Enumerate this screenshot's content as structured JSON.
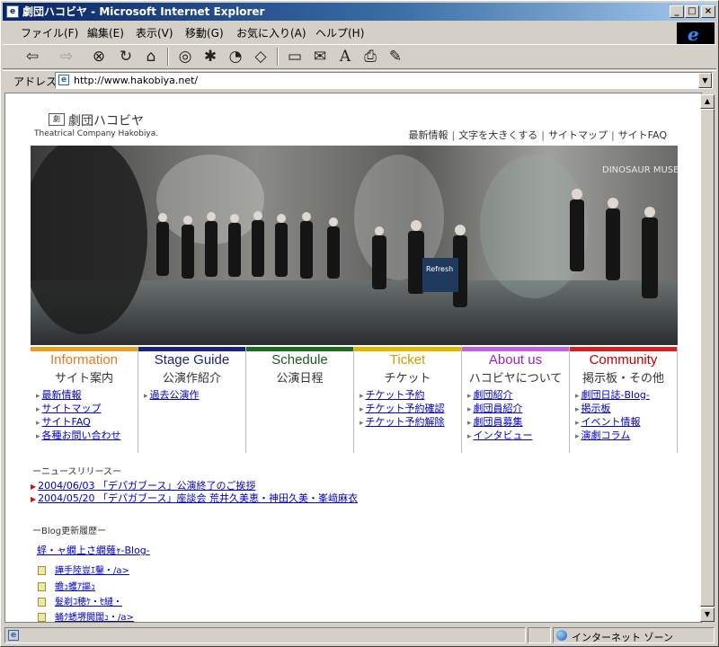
{
  "window": {
    "title": "劇団ハコビヤ - Microsoft Internet Explorer",
    "controls": [
      "_",
      "□",
      "×"
    ]
  },
  "menu": [
    "ファイル(F)",
    "編集(E)",
    "表示(V)",
    "移動(G)",
    "お気に入り(A)",
    "ヘルプ(H)"
  ],
  "toolbar": {
    "back": "⇦",
    "forward": "⇨",
    "stop": "⊗",
    "refresh": "↻",
    "home": "⌂",
    "search": "◎",
    "favorites": "✱",
    "history": "◔",
    "channels": "◇",
    "fullscreen": "▭",
    "mail": "✉",
    "font": "A",
    "print": "⎙",
    "edit": "✎"
  },
  "address": {
    "label": "アドレス",
    "url": "http://www.hakobiya.net/"
  },
  "page": {
    "logo_mark": "劇",
    "logo_jp": "劇団ハコビヤ",
    "logo_en": "Theatrical Company Hakobiya.",
    "topnav": [
      "最新情報",
      "文字を大きくする",
      "サイトマップ",
      "サイトFAQ"
    ],
    "hero_sign": "DINOSAUR MUSEUM",
    "hero_shirt": "Refresh",
    "categories": [
      {
        "en": "Information",
        "jp": "サイト案内",
        "color": "#e87722",
        "bar": "#e8a020",
        "links": [
          "最新情報",
          "サイトマップ",
          "サイトFAQ",
          "各種お問い合わせ"
        ]
      },
      {
        "en": "Stage Guide",
        "jp": "公演作紹介",
        "color": "#1a237e",
        "bar": "#1a237e",
        "links": [
          "過去公演作"
        ]
      },
      {
        "en": "Schedule",
        "jp": "公演日程",
        "color": "#1b5e20",
        "bar": "#1b6e20",
        "links": []
      },
      {
        "en": "Ticket",
        "jp": "チケット",
        "color": "#c9a000",
        "bar": "#e0b800",
        "links": [
          "チケット予約",
          "チケット予約確認",
          "チケット予約解除"
        ]
      },
      {
        "en": "About us",
        "jp": "ハコビヤについて",
        "color": "#a020c0",
        "bar": "#c060e0",
        "links": [
          "劇団紹介",
          "劇団員紹介",
          "劇団員募集",
          "インタビュー"
        ]
      },
      {
        "en": "Community",
        "jp": "掲示板・その他",
        "color": "#c00000",
        "bar": "#d42020",
        "links": [
          "劇団日誌-Blog-",
          "掲示板",
          "イベント情報",
          "演劇コラム"
        ]
      }
    ],
    "news_title": "ーニュースリリースー",
    "news": [
      "2004/06/03 「デパガブース」公演終了のご挨拶",
      "2004/05/20 「デパガブース」座談会 荒井久美恵・神田久美・峯﨑麻衣"
    ],
    "blog_title": "ーBlog更新履歴ー",
    "blog_link": "蜉・ャ繝上さ繝薙ｬ-Blog-",
    "blog_items": [
      "譁手陸豈ｴ鑿・/a>",
      "蟾ｭ蠖ｱ謳ｭ",
      "髮剃ｺ穂ｹ・ｾ縺・",
      "蛹ｸ蟋堺閧闊ｭ・/a>"
    ]
  },
  "status": {
    "left": "",
    "zone": "インターネット ゾーン"
  },
  "colors": {
    "titlebar_start": "#0a246a",
    "titlebar_end": "#a6caf0",
    "link": "#0000cc"
  }
}
